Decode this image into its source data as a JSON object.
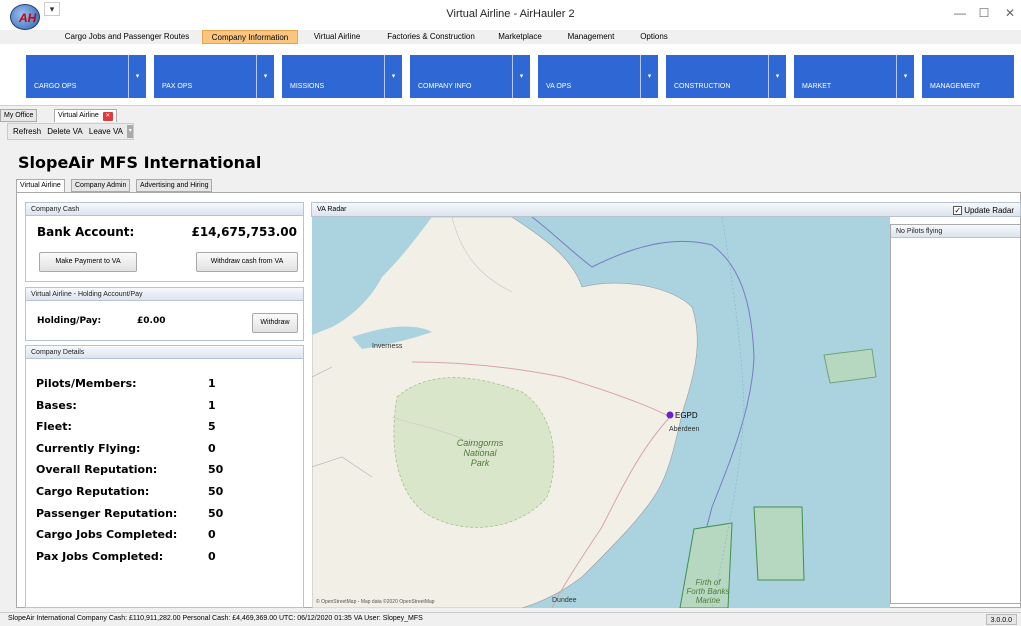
{
  "window": {
    "title": "Virtual Airline - AirHauler 2",
    "logo_text": "AH"
  },
  "menu": [
    {
      "label": "Cargo Jobs and Passenger Routes",
      "active": false
    },
    {
      "label": "Company Information",
      "active": true
    },
    {
      "label": "Virtual Airline",
      "active": false
    },
    {
      "label": "Factories & Construction",
      "active": false
    },
    {
      "label": "Marketplace",
      "active": false
    },
    {
      "label": "Management",
      "active": false
    },
    {
      "label": "Options",
      "active": false
    }
  ],
  "ribbon": [
    "CARGO OPS",
    "PAX OPS",
    "MISSIONS",
    "COMPANY INFO",
    "VA OPS",
    "CONSTRUCTION",
    "MARKET",
    "MANAGEMENT"
  ],
  "doc_tabs": [
    "My Office",
    "Virtual Airline"
  ],
  "toolbar": {
    "refresh": "Refresh",
    "delete": "Delete VA",
    "leave": "Leave VA"
  },
  "va_name": "SlopeAir MFS International",
  "sub_tabs": [
    "Virtual Airline",
    "Company Admin",
    "Advertising and Hiring"
  ],
  "company_cash": {
    "header": "Company Cash",
    "bank_label": "Bank Account:",
    "bank_value": "£14,675,753.00",
    "pay_button": "Make Payment to VA",
    "withdraw_button": "Withdraw cash from VA"
  },
  "holding": {
    "header": "Virtual Airline - Holding Account/Pay",
    "label": "Holding/Pay:",
    "value": "£0.00",
    "button": "Withdraw"
  },
  "details": {
    "header": "Company Details",
    "rows": [
      {
        "label": "Pilots/Members:",
        "value": "1"
      },
      {
        "label": "Bases:",
        "value": "1"
      },
      {
        "label": "Fleet:",
        "value": "5"
      },
      {
        "label": "Currently Flying:",
        "value": "0"
      },
      {
        "label": "Overall Reputation:",
        "value": "50"
      },
      {
        "label": "Cargo Reputation:",
        "value": "50"
      },
      {
        "label": "Passenger Reputation:",
        "value": "50"
      },
      {
        "label": "Cargo Jobs Completed:",
        "value": "0"
      },
      {
        "label": "Pax Jobs Completed:",
        "value": "0"
      }
    ]
  },
  "radar": {
    "header": "VA Radar",
    "update_label": "Update Radar",
    "update_checked": true,
    "map_labels": {
      "inverness": "Inverness",
      "aberdeen": "Aberdeen",
      "egpd": "EGPD",
      "dundee": "Dundee",
      "park": [
        "Cairngorms",
        "National",
        "Park"
      ],
      "firth": [
        "Firth of",
        "Forth Banks",
        "Marine"
      ],
      "attribution": "© OpenStreetMap - Map data ©2020 OpenStreetMap"
    }
  },
  "pilots_panel": {
    "header": "No Pilots flying"
  },
  "status_bar": {
    "text": "SlopeAir International   Company Cash: £110,911,282.00   Personal Cash: £4,469,369.00   UTC: 06/12/2020  01:35   VA User: Slopey_MFS",
    "version": "3.0.0.0"
  },
  "colors": {
    "ribbon": "#2f67d4",
    "active_menu": "#fac67f",
    "marker": "#6a1fd0"
  }
}
